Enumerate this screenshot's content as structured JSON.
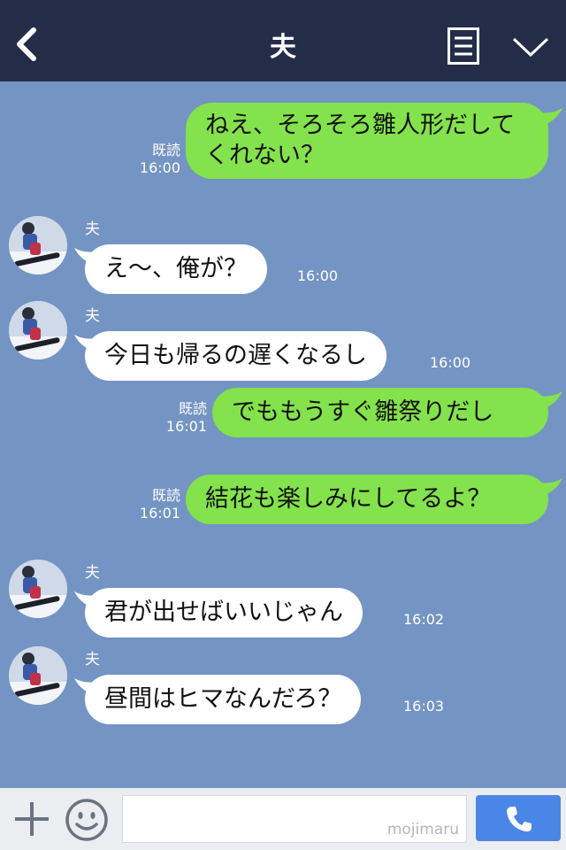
{
  "header": {
    "title": "夫"
  },
  "messages": [
    {
      "type": "out",
      "text": "ねえ、そろそろ雛人形だしてくれない？",
      "read": "既読",
      "time": "16:00"
    },
    {
      "type": "in",
      "sender": "夫",
      "text": "え〜、俺が？",
      "time": "16:00"
    },
    {
      "type": "in",
      "sender": "夫",
      "text": "今日も帰るの遅くなるし",
      "time": "16:00"
    },
    {
      "type": "out",
      "text": "でももうすぐ雛祭りだし",
      "read": "既読",
      "time": "16:01"
    },
    {
      "type": "out",
      "text": "結花も楽しみにしてるよ？",
      "read": "既読",
      "time": "16:01"
    },
    {
      "type": "in",
      "sender": "夫",
      "text": "君が出せばいいじゃん",
      "time": "16:02"
    },
    {
      "type": "in",
      "sender": "夫",
      "text": "昼間はヒマなんだろ？",
      "time": "16:03"
    }
  ],
  "input": {
    "watermark": "mojimaru"
  },
  "colors": {
    "header": "#242d48",
    "background": "#7494c3",
    "outgoing": "#84e24c",
    "incoming": "#ffffff",
    "send": "#4a86e6"
  },
  "icons": [
    "back-icon",
    "menu-icon",
    "chevron-down-icon",
    "plus-icon",
    "smile-icon",
    "phone-icon"
  ]
}
